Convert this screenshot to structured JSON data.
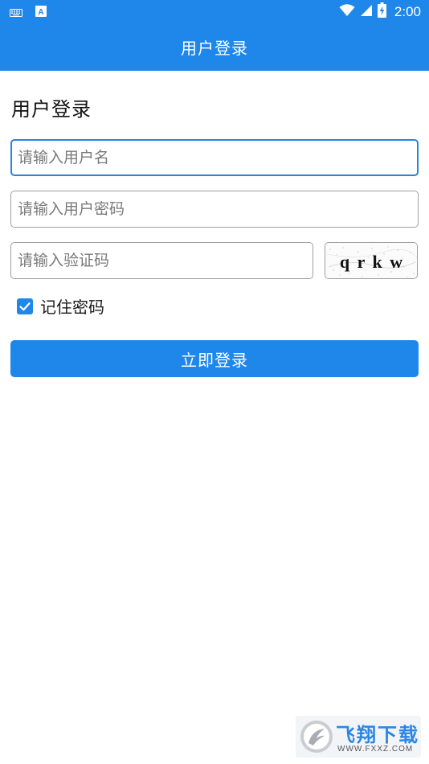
{
  "status_bar": {
    "time": "2:00",
    "left_icons": [
      "keyboard-icon",
      "font-a-icon"
    ],
    "right_icons": [
      "wifi-icon",
      "signal-icon",
      "battery-charging-icon"
    ]
  },
  "app_bar": {
    "title": "用户登录"
  },
  "form": {
    "heading": "用户登录",
    "username": {
      "value": "",
      "placeholder": "请输入用户名"
    },
    "password": {
      "value": "",
      "placeholder": "请输入用户密码"
    },
    "captcha_input": {
      "value": "",
      "placeholder": "请输入验证码"
    },
    "captcha_image_text": "q r k w",
    "remember": {
      "label": "记住密码",
      "checked": true
    },
    "submit_label": "立即登录"
  },
  "watermark": {
    "brand": "飞翔下载",
    "url": "WWW.FXXZ.COM"
  },
  "colors": {
    "primary": "#1f87ea",
    "focus_border": "#2b82d9",
    "field_border": "#9e9e9e"
  }
}
